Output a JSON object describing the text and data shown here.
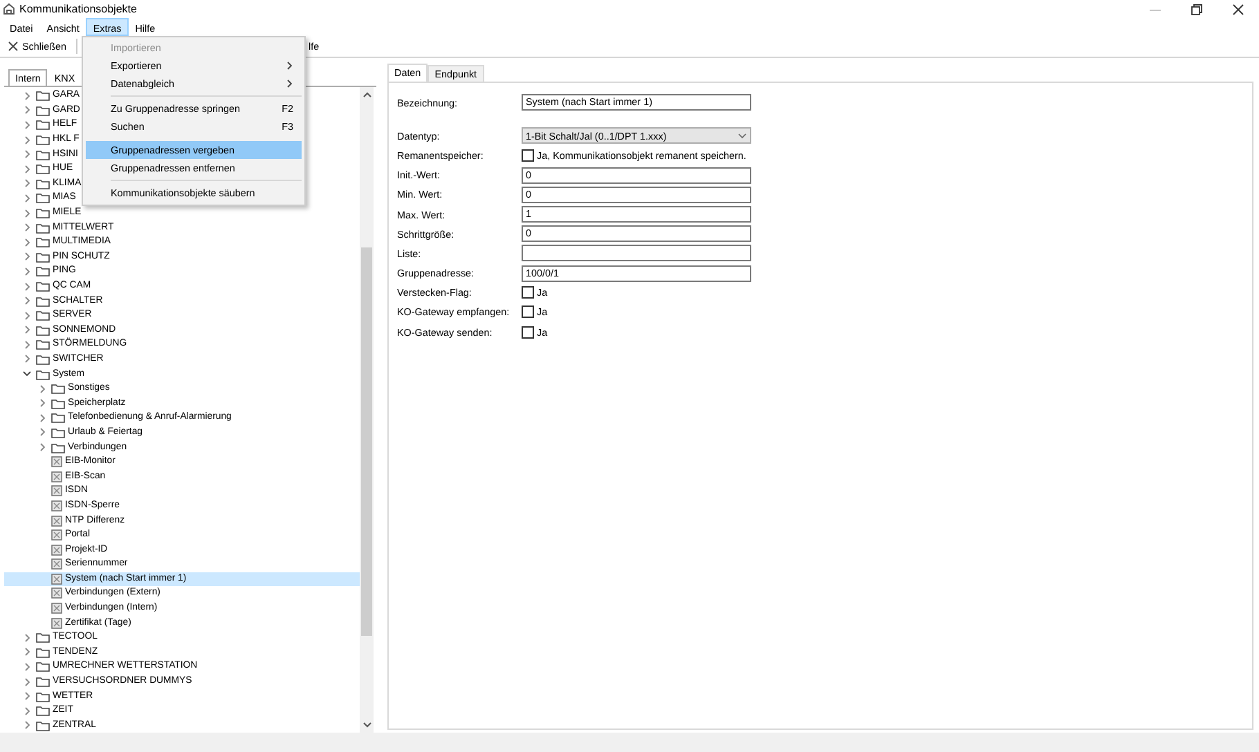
{
  "window": {
    "title": "Kommunikationsobjekte"
  },
  "menu_bar": [
    {
      "label": "Datei",
      "selected": false
    },
    {
      "label": "Ansicht",
      "selected": false
    },
    {
      "label": "Extras",
      "selected": true
    },
    {
      "label": "Hilfe",
      "selected": false
    }
  ],
  "toolbar": [
    {
      "label": "Schließen",
      "kind": "close"
    },
    {
      "label": "lfe",
      "kind": "plain"
    }
  ],
  "extras_menu": [
    {
      "kind": "item",
      "label": "Importieren",
      "disabled": true,
      "selected": false
    },
    {
      "kind": "submenu",
      "label": "Exportieren",
      "disabled": false,
      "selected": false
    },
    {
      "kind": "submenu",
      "label": "Datenabgleich",
      "disabled": false,
      "selected": false
    },
    {
      "kind": "separator"
    },
    {
      "kind": "item",
      "label": "Zu Gruppenadresse springen",
      "shortcut": "F2",
      "disabled": false,
      "selected": false
    },
    {
      "kind": "item",
      "label": "Suchen",
      "shortcut": "F3",
      "disabled": false,
      "selected": false
    },
    {
      "kind": "item",
      "label": "Gruppenadressen vergeben",
      "disabled": false,
      "selected": true
    },
    {
      "kind": "item",
      "label": "Gruppenadressen entfernen",
      "disabled": false,
      "selected": false
    },
    {
      "kind": "separator"
    },
    {
      "kind": "item",
      "label": "Kommunikationsobjekte säubern",
      "disabled": false,
      "selected": false
    }
  ],
  "left_panel": {
    "tabs": [
      {
        "label": "Intern",
        "selected": true
      },
      {
        "label": "KNX",
        "selected": false
      }
    ],
    "tree": [
      {
        "kind": "folder",
        "label": "GARA",
        "expanded": false,
        "selected": false
      },
      {
        "kind": "folder",
        "label": "GARD",
        "expanded": false,
        "selected": false
      },
      {
        "kind": "folder",
        "label": "HELF",
        "expanded": false,
        "selected": false
      },
      {
        "kind": "folder",
        "label": "HKL F",
        "expanded": false,
        "selected": false
      },
      {
        "kind": "folder",
        "label": "HSINI",
        "expanded": false,
        "selected": false
      },
      {
        "kind": "folder",
        "label": "HUE",
        "expanded": false,
        "selected": false
      },
      {
        "kind": "folder",
        "label": "KLIMA",
        "expanded": false,
        "selected": false
      },
      {
        "kind": "folder",
        "label": "MIAS",
        "expanded": false,
        "selected": false
      },
      {
        "kind": "folder",
        "label": "MIELE",
        "expanded": false,
        "selected": false
      },
      {
        "kind": "folder",
        "label": "MITTELWERT",
        "expanded": false,
        "selected": false
      },
      {
        "kind": "folder",
        "label": "MULTIMEDIA",
        "expanded": false,
        "selected": false
      },
      {
        "kind": "folder",
        "label": "PIN SCHUTZ",
        "expanded": false,
        "selected": false
      },
      {
        "kind": "folder",
        "label": "PING",
        "expanded": false,
        "selected": false
      },
      {
        "kind": "folder",
        "label": "QC CAM",
        "expanded": false,
        "selected": false
      },
      {
        "kind": "folder",
        "label": "SCHALTER",
        "expanded": false,
        "selected": false
      },
      {
        "kind": "folder",
        "label": "SERVER",
        "expanded": false,
        "selected": false
      },
      {
        "kind": "folder",
        "label": "SONNEMOND",
        "expanded": false,
        "selected": false
      },
      {
        "kind": "folder",
        "label": "STÖRMELDUNG",
        "expanded": false,
        "selected": false
      },
      {
        "kind": "folder",
        "label": "SWITCHER",
        "expanded": false,
        "selected": false
      },
      {
        "kind": "folder",
        "label": "System",
        "expanded": true,
        "selected": false,
        "children": [
          {
            "kind": "folder",
            "label": "Sonstiges",
            "expanded": false,
            "selected": false
          },
          {
            "kind": "folder",
            "label": "Speicherplatz",
            "expanded": false,
            "selected": false
          },
          {
            "kind": "folder",
            "label": "Telefonbedienung & Anruf-Alarmierung",
            "expanded": false,
            "selected": false
          },
          {
            "kind": "folder",
            "label": "Urlaub & Feiertag",
            "expanded": false,
            "selected": false
          },
          {
            "kind": "folder",
            "label": "Verbindungen",
            "expanded": false,
            "selected": false
          },
          {
            "kind": "object",
            "label": "EIB-Monitor",
            "selected": false
          },
          {
            "kind": "object",
            "label": "EIB-Scan",
            "selected": false
          },
          {
            "kind": "object",
            "label": "ISDN",
            "selected": false
          },
          {
            "kind": "object",
            "label": "ISDN-Sperre",
            "selected": false
          },
          {
            "kind": "object",
            "label": "NTP Differenz",
            "selected": false
          },
          {
            "kind": "object",
            "label": "Portal",
            "selected": false
          },
          {
            "kind": "object",
            "label": "Projekt-ID",
            "selected": false
          },
          {
            "kind": "object",
            "label": "Seriennummer",
            "selected": false
          },
          {
            "kind": "object",
            "label": "System (nach Start immer 1)",
            "selected": true
          },
          {
            "kind": "object",
            "label": "Verbindungen (Extern)",
            "selected": false
          },
          {
            "kind": "object",
            "label": "Verbindungen (Intern)",
            "selected": false
          },
          {
            "kind": "object",
            "label": "Zertifikat (Tage)",
            "selected": false
          }
        ]
      },
      {
        "kind": "folder",
        "label": "TECTOOL",
        "expanded": false,
        "selected": false
      },
      {
        "kind": "folder",
        "label": "TENDENZ",
        "expanded": false,
        "selected": false
      },
      {
        "kind": "folder",
        "label": "UMRECHNER WETTERSTATION",
        "expanded": false,
        "selected": false
      },
      {
        "kind": "folder",
        "label": "VERSUCHSORDNER DUMMYS",
        "expanded": false,
        "selected": false
      },
      {
        "kind": "folder",
        "label": "WETTER",
        "expanded": false,
        "selected": false
      },
      {
        "kind": "folder",
        "label": "ZEIT",
        "expanded": false,
        "selected": false
      },
      {
        "kind": "folder",
        "label": "ZENTRAL",
        "expanded": false,
        "selected": false
      }
    ]
  },
  "right_panel": {
    "tabs": [
      {
        "label": "Daten",
        "selected": true
      },
      {
        "label": "Endpunkt",
        "selected": false
      }
    ],
    "fields": [
      {
        "kind": "text",
        "label": "Bezeichnung:",
        "value": "System (nach Start immer 1)"
      },
      {
        "kind": "select",
        "label": "Datentyp:",
        "value": "1-Bit Schalt/Jal (0..1/DPT 1.xxx)"
      },
      {
        "kind": "checkbox",
        "label": "Remanentspeicher:",
        "text": "Ja, Kommunikationsobjekt remanent speichern.",
        "checked": false
      },
      {
        "kind": "text",
        "label": "Init.-Wert:",
        "value": "0"
      },
      {
        "kind": "text",
        "label": "Min. Wert:",
        "value": "0"
      },
      {
        "kind": "text",
        "label": "Max. Wert:",
        "value": "1"
      },
      {
        "kind": "text",
        "label": "Schrittgröße:",
        "value": "0"
      },
      {
        "kind": "text",
        "label": "Liste:"
      },
      {
        "kind": "text",
        "label": "Gruppenadresse:",
        "value": "100/0/1"
      },
      {
        "kind": "checkbox",
        "label": "Verstecken-Flag:",
        "text": "Ja",
        "checked": false
      },
      {
        "kind": "checkbox",
        "label": "KO-Gateway empfangen:",
        "text": "Ja",
        "checked": false
      },
      {
        "kind": "checkbox",
        "label": "KO-Gateway senden:",
        "text": "Ja",
        "checked": false
      }
    ]
  }
}
